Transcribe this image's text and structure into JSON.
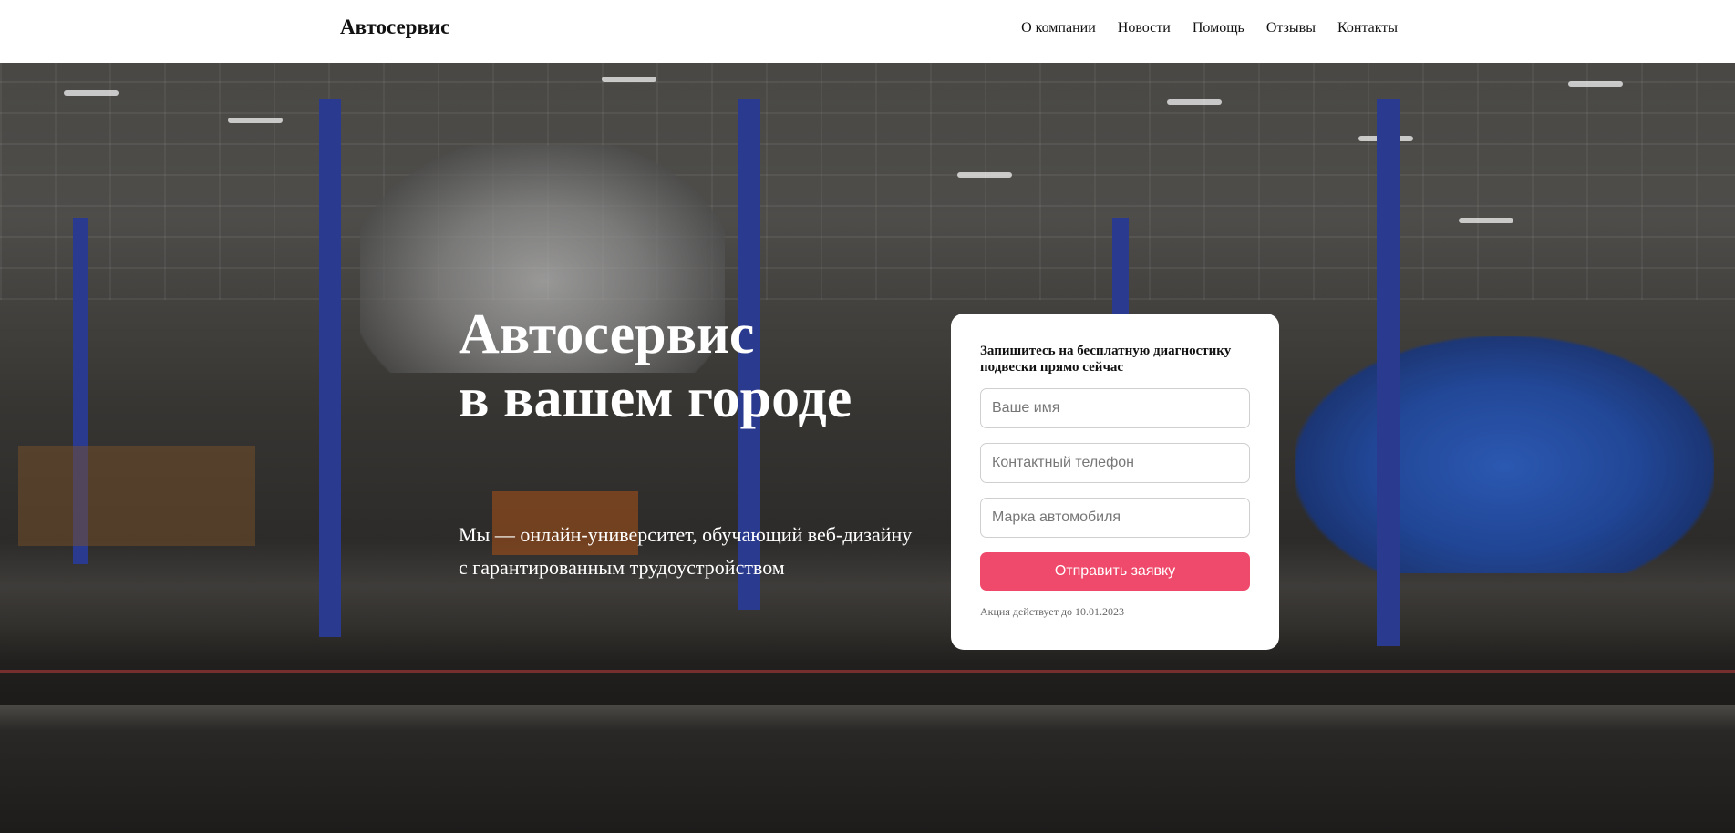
{
  "header": {
    "logo": "Автосервис",
    "nav": [
      "О компании",
      "Новости",
      "Помощь",
      "Отзывы",
      "Контакты"
    ]
  },
  "hero": {
    "title_line1": "Автосервис",
    "title_line2": "в вашем городе",
    "subtitle": "Мы — онлайн-университет, обучающий веб-дизайну с гарантированным трудоустройством"
  },
  "form": {
    "title": "Запишитесь на бесплатную диагностику подвески прямо сейчас",
    "name_placeholder": "Ваше имя",
    "phone_placeholder": "Контактный телефон",
    "car_placeholder": "Марка автомобиля",
    "submit_label": "Отправить заявку",
    "note": "Акция действует до 10.01.2023"
  },
  "colors": {
    "accent": "#ef4a6b",
    "header_bg": "#ffffff",
    "card_bg": "#ffffff"
  }
}
